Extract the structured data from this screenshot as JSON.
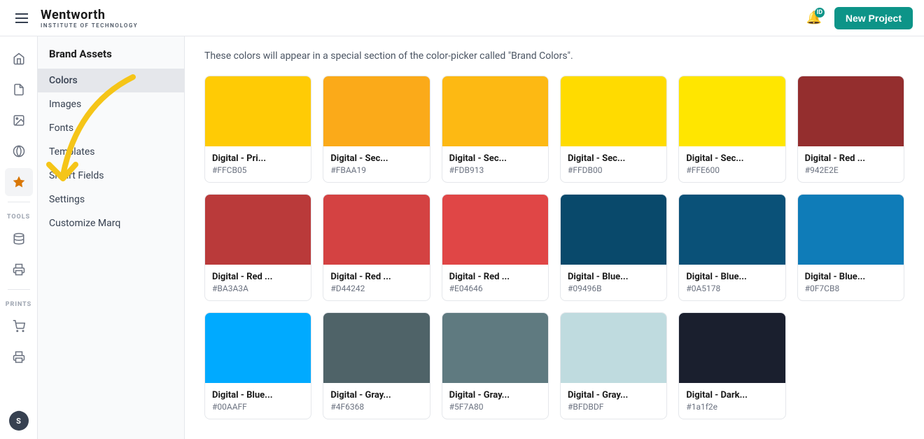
{
  "topbar": {
    "logo_name": "Wentworth",
    "logo_sub": "Institute of Technology",
    "notif_badge": "ID",
    "new_project_label": "New Project"
  },
  "nav_sidebar": {
    "header": "Brand Assets",
    "items": [
      {
        "id": "colors",
        "label": "Colors",
        "active": true
      },
      {
        "id": "images",
        "label": "Images",
        "active": false
      },
      {
        "id": "fonts",
        "label": "Fonts",
        "active": false
      },
      {
        "id": "templates",
        "label": "Templates",
        "active": false
      },
      {
        "id": "smart-fields",
        "label": "Smart Fields",
        "active": false
      },
      {
        "id": "settings",
        "label": "Settings",
        "active": false
      },
      {
        "id": "customize",
        "label": "Customize Marq",
        "active": false
      }
    ]
  },
  "content": {
    "description": "These colors will appear in a special section of the color-picker called \"Brand Colors\".",
    "colors": [
      {
        "name": "Digital - Pri...",
        "hex": "#FFCB05",
        "display_hex": "#FFCB05"
      },
      {
        "name": "Digital - Sec...",
        "hex": "#FBAA19",
        "display_hex": "#FBAA19"
      },
      {
        "name": "Digital - Sec...",
        "hex": "#FDB913",
        "display_hex": "#FDB913"
      },
      {
        "name": "Digital - Sec...",
        "hex": "#FFDB00",
        "display_hex": "#FFDB00"
      },
      {
        "name": "Digital - Sec...",
        "hex": "#FFE600",
        "display_hex": "#FFE600"
      },
      {
        "name": "Digital - Red ...",
        "hex": "#942E2E",
        "display_hex": "#942E2E"
      },
      {
        "name": "Digital - Red ...",
        "hex": "#BA3A3A",
        "display_hex": "#BA3A3A"
      },
      {
        "name": "Digital - Red ...",
        "hex": "#D44242",
        "display_hex": "#D44242"
      },
      {
        "name": "Digital - Red ...",
        "hex": "#E04646",
        "display_hex": "#E04646"
      },
      {
        "name": "Digital - Blue...",
        "hex": "#09496B",
        "display_hex": "#09496B"
      },
      {
        "name": "Digital - Blue...",
        "hex": "#0A5178",
        "display_hex": "#0A5178"
      },
      {
        "name": "Digital - Blue...",
        "hex": "#0F7CB8",
        "display_hex": "#0F7CB8"
      },
      {
        "name": "Digital - Blue...",
        "hex": "#00AAFF",
        "display_hex": "#00AAFF"
      },
      {
        "name": "Digital - Gray...",
        "hex": "#4F6368",
        "display_hex": "#4F6368"
      },
      {
        "name": "Digital - Gray...",
        "hex": "#5F7A80",
        "display_hex": "#5F7A80"
      },
      {
        "name": "Digital - Gray...",
        "hex": "#BFDBDF",
        "display_hex": "#BFDBDF"
      },
      {
        "name": "Digital - Dark...",
        "hex": "#1a1f2e",
        "display_hex": "#1a1f2e"
      }
    ]
  },
  "icon_sidebar": {
    "items": [
      {
        "id": "home",
        "icon": "⌂",
        "label": "Home"
      },
      {
        "id": "file",
        "icon": "◻",
        "label": "File"
      },
      {
        "id": "image",
        "icon": "▣",
        "label": "Image"
      },
      {
        "id": "brand",
        "icon": "◈",
        "label": "Brand"
      },
      {
        "id": "star",
        "icon": "★",
        "label": "Star"
      }
    ],
    "tools_label": "TOOLS",
    "prints_label": "PRINTS",
    "user_initial": "S"
  }
}
